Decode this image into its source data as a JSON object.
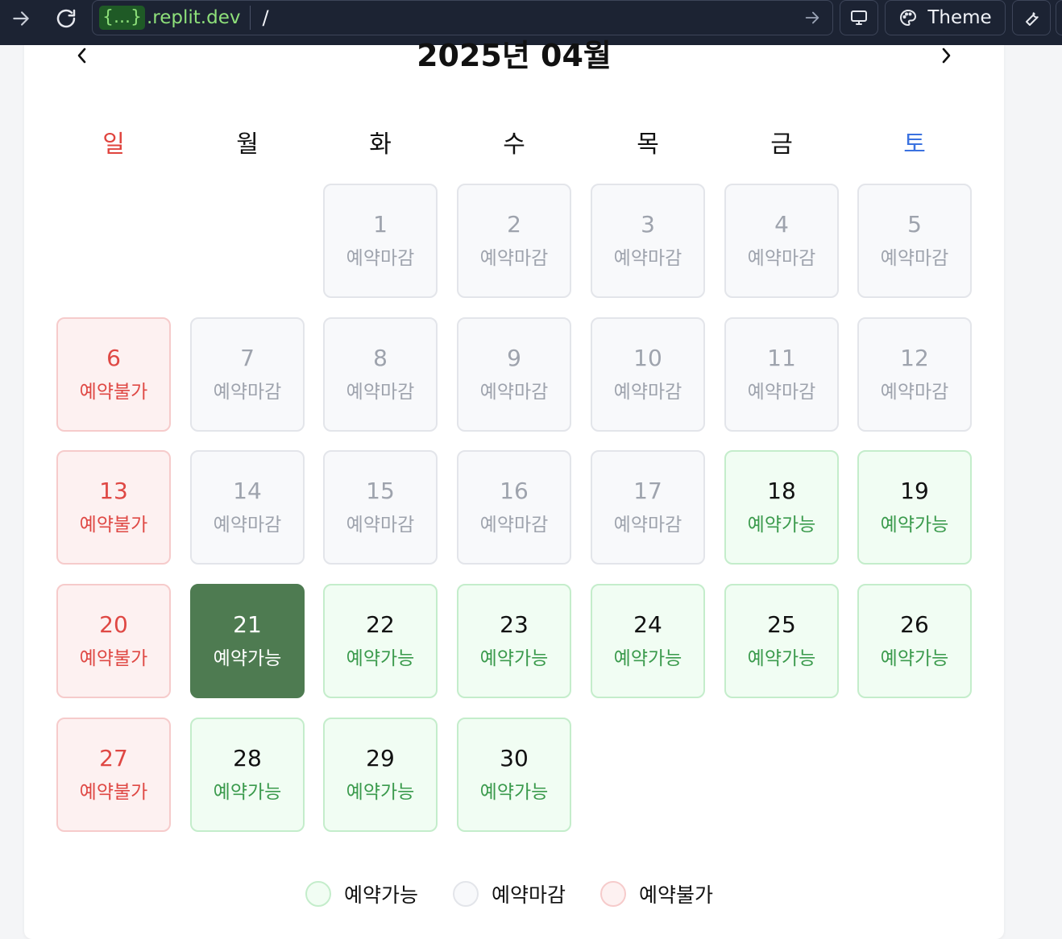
{
  "browser": {
    "url_logo": "{...}",
    "url_domain": ".replit.dev",
    "url_path": "/",
    "theme_label": "Theme"
  },
  "calendar": {
    "title": "2025년 04월",
    "weekdays": [
      "일",
      "월",
      "화",
      "수",
      "목",
      "금",
      "토"
    ],
    "status_labels": {
      "available": "예약가능",
      "closed": "예약마감",
      "unavailable": "예약불가"
    },
    "selected_day": 21,
    "days": [
      {
        "day": "1",
        "status": "예약마감",
        "type": "closed"
      },
      {
        "day": "2",
        "status": "예약마감",
        "type": "closed"
      },
      {
        "day": "3",
        "status": "예약마감",
        "type": "closed"
      },
      {
        "day": "4",
        "status": "예약마감",
        "type": "closed"
      },
      {
        "day": "5",
        "status": "예약마감",
        "type": "closed"
      },
      {
        "day": "6",
        "status": "예약불가",
        "type": "unavail"
      },
      {
        "day": "7",
        "status": "예약마감",
        "type": "closed"
      },
      {
        "day": "8",
        "status": "예약마감",
        "type": "closed"
      },
      {
        "day": "9",
        "status": "예약마감",
        "type": "closed"
      },
      {
        "day": "10",
        "status": "예약마감",
        "type": "closed"
      },
      {
        "day": "11",
        "status": "예약마감",
        "type": "closed"
      },
      {
        "day": "12",
        "status": "예약마감",
        "type": "closed"
      },
      {
        "day": "13",
        "status": "예약불가",
        "type": "unavail"
      },
      {
        "day": "14",
        "status": "예약마감",
        "type": "closed"
      },
      {
        "day": "15",
        "status": "예약마감",
        "type": "closed"
      },
      {
        "day": "16",
        "status": "예약마감",
        "type": "closed"
      },
      {
        "day": "17",
        "status": "예약마감",
        "type": "closed"
      },
      {
        "day": "18",
        "status": "예약가능",
        "type": "avail"
      },
      {
        "day": "19",
        "status": "예약가능",
        "type": "avail"
      },
      {
        "day": "20",
        "status": "예약불가",
        "type": "unavail"
      },
      {
        "day": "21",
        "status": "예약가능",
        "type": "selected"
      },
      {
        "day": "22",
        "status": "예약가능",
        "type": "avail"
      },
      {
        "day": "23",
        "status": "예약가능",
        "type": "avail"
      },
      {
        "day": "24",
        "status": "예약가능",
        "type": "avail"
      },
      {
        "day": "25",
        "status": "예약가능",
        "type": "avail"
      },
      {
        "day": "26",
        "status": "예약가능",
        "type": "avail"
      },
      {
        "day": "27",
        "status": "예약불가",
        "type": "unavail"
      },
      {
        "day": "28",
        "status": "예약가능",
        "type": "avail"
      },
      {
        "day": "29",
        "status": "예약가능",
        "type": "avail"
      },
      {
        "day": "30",
        "status": "예약가능",
        "type": "avail"
      }
    ]
  },
  "legend": [
    {
      "label": "예약가능",
      "type": "avail"
    },
    {
      "label": "예약마감",
      "type": "closed"
    },
    {
      "label": "예약불가",
      "type": "unavail"
    }
  ],
  "colors": {
    "topbar_bg": "#1c2333",
    "url_green": "#8ee07a",
    "sunday": "#e0443e",
    "saturday": "#3b72e0",
    "available_text": "#3a9a4c",
    "selected_bg": "#4e7b51",
    "unavailable_text": "#df4844"
  }
}
